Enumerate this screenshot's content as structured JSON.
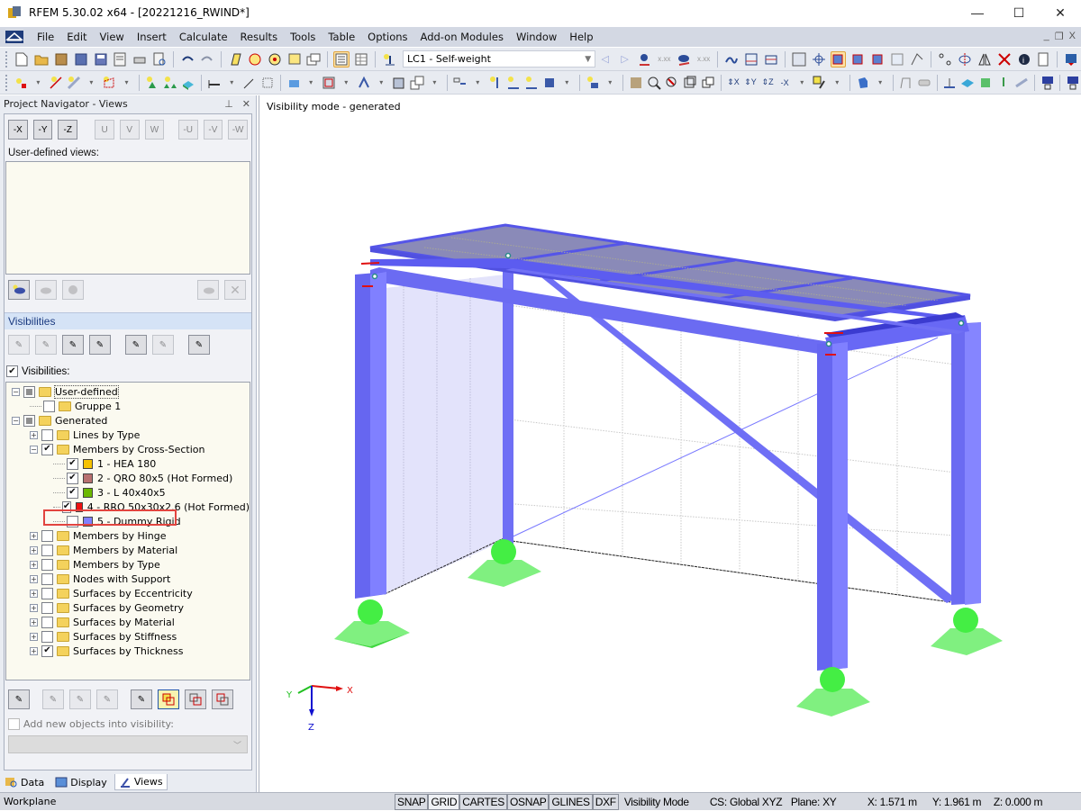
{
  "window": {
    "title": "RFEM 5.30.02 x64 - [20221216_RWIND*]",
    "minimize": "—",
    "maximize": "☐",
    "close": "✕"
  },
  "menubar": {
    "items": [
      {
        "label": "File"
      },
      {
        "label": "Edit"
      },
      {
        "label": "View"
      },
      {
        "label": "Insert"
      },
      {
        "label": "Calculate"
      },
      {
        "label": "Results"
      },
      {
        "label": "Tools"
      },
      {
        "label": "Table"
      },
      {
        "label": "Options"
      },
      {
        "label": "Add-on Modules"
      },
      {
        "label": "Window"
      },
      {
        "label": "Help"
      }
    ],
    "mdi_minimize": "_",
    "mdi_restore": "❐",
    "mdi_close": "X"
  },
  "toolbar": {
    "load_case": "LC1 - Self-weight"
  },
  "navigator": {
    "title": "Project Navigator - Views",
    "pin": "ᵖ",
    "close": "✕",
    "view_buttons": [
      "-X",
      "-Y",
      "-Z",
      "U",
      "V",
      "W",
      "-U",
      "-V",
      "-W"
    ],
    "user_defined_views_label": "User-defined views:",
    "visibilities_section_title": "Visibilities",
    "visibilities_checkbox_label": "Visibilities:",
    "visibilities_checked": true,
    "tree": [
      {
        "level": 0,
        "expander": "−",
        "check": "partial",
        "icon": "folder",
        "label": "User-defined",
        "focused": true
      },
      {
        "level": 1,
        "expander": "",
        "check": "unchecked",
        "icon": "folder",
        "label": "Gruppe 1"
      },
      {
        "level": 0,
        "expander": "−",
        "check": "partial",
        "icon": "folder",
        "label": "Generated"
      },
      {
        "level": 1,
        "expander": "+",
        "check": "unchecked",
        "icon": "folder",
        "label": "Lines by Type"
      },
      {
        "level": 1,
        "expander": "−",
        "check": "checked",
        "icon": "folder",
        "label": "Members by Cross-Section"
      },
      {
        "level": 2,
        "expander": "",
        "check": "checked",
        "icon": "swatch",
        "color": "#f5c200",
        "label": "1 - HEA 180"
      },
      {
        "level": 2,
        "expander": "",
        "check": "checked",
        "icon": "swatch",
        "color": "#b87070",
        "label": "2 - QRO 80x5 (Hot Formed)"
      },
      {
        "level": 2,
        "expander": "",
        "check": "checked",
        "icon": "swatch",
        "color": "#6cb800",
        "label": "3 - L 40x40x5"
      },
      {
        "level": 2,
        "expander": "",
        "check": "checked",
        "icon": "swatch",
        "color": "#ee1111",
        "label": "4 - RRO 50x30x2.6 (Hot Formed)"
      },
      {
        "level": 2,
        "expander": "",
        "check": "unchecked",
        "icon": "swatch",
        "color": "#8080ff",
        "label": "5 - Dummy Rigid",
        "highlighted": true
      },
      {
        "level": 1,
        "expander": "+",
        "check": "unchecked",
        "icon": "folder",
        "label": "Members by Hinge"
      },
      {
        "level": 1,
        "expander": "+",
        "check": "unchecked",
        "icon": "folder",
        "label": "Members by Material"
      },
      {
        "level": 1,
        "expander": "+",
        "check": "unchecked",
        "icon": "folder",
        "label": "Members by Type"
      },
      {
        "level": 1,
        "expander": "+",
        "check": "unchecked",
        "icon": "folder",
        "label": "Nodes with Support"
      },
      {
        "level": 1,
        "expander": "+",
        "check": "unchecked",
        "icon": "folder",
        "label": "Surfaces by Eccentricity"
      },
      {
        "level": 1,
        "expander": "+",
        "check": "unchecked",
        "icon": "folder",
        "label": "Surfaces by Geometry"
      },
      {
        "level": 1,
        "expander": "+",
        "check": "unchecked",
        "icon": "folder",
        "label": "Surfaces by Material"
      },
      {
        "level": 1,
        "expander": "+",
        "check": "unchecked",
        "icon": "folder",
        "label": "Surfaces by Stiffness"
      },
      {
        "level": 1,
        "expander": "+",
        "check": "checked",
        "icon": "folder",
        "label": "Surfaces by Thickness"
      }
    ],
    "add_new_objects_label": "Add new objects into visibility:",
    "add_new_objects_checked": false,
    "tabs": [
      {
        "label": "Data",
        "active": false
      },
      {
        "label": "Display",
        "active": false
      },
      {
        "label": "Views",
        "active": true
      }
    ]
  },
  "viewport": {
    "mode_label": "Visibility mode - generated",
    "axes": {
      "x": "X",
      "y": "Y",
      "z": "Z"
    },
    "colors": {
      "member": "#6b6bff",
      "member_dark": "#4a4ae0",
      "roof": "#8a8ab8",
      "wall": "#e0e0fa",
      "support": "#44ee44",
      "support_base": "#3fd83f"
    }
  },
  "statusbar": {
    "workplane": "Workplane",
    "toggles": [
      {
        "label": "SNAP",
        "on": false
      },
      {
        "label": "GRID",
        "on": true
      },
      {
        "label": "CARTES",
        "on": false
      },
      {
        "label": "OSNAP",
        "on": false
      },
      {
        "label": "GLINES",
        "on": false
      },
      {
        "label": "DXF",
        "on": false
      }
    ],
    "mode": "Visibility Mode",
    "cs": "CS: Global XYZ",
    "plane": "Plane: XY",
    "x": "X:  1.571 m",
    "y": "Y:  1.961 m",
    "z": "Z:  0.000 m"
  }
}
